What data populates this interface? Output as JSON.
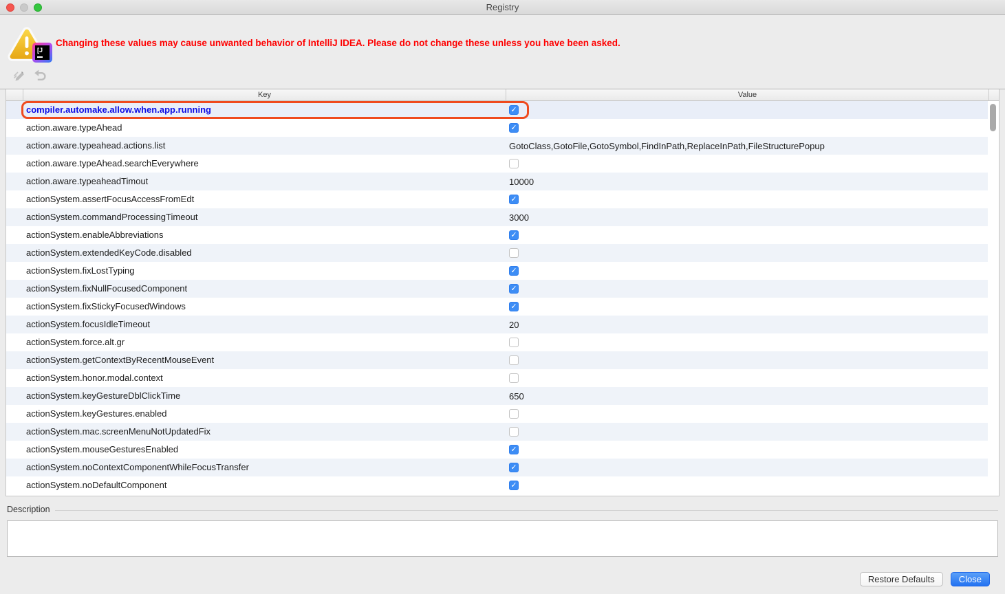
{
  "window": {
    "title": "Registry"
  },
  "warning": {
    "text": "Changing these values may cause unwanted behavior of IntelliJ IDEA. Please do not change these unless you have been asked.",
    "logo_text": "[J"
  },
  "toolbar": {
    "icons": [
      "edit-icon",
      "revert-icon"
    ]
  },
  "table": {
    "header": {
      "key": "Key",
      "value": "Value"
    },
    "rows": [
      {
        "key": "compiler.automake.allow.when.app.running",
        "type": "checkbox",
        "checked": true,
        "selected": true,
        "highlighted": true
      },
      {
        "key": "action.aware.typeAhead",
        "type": "checkbox",
        "checked": true
      },
      {
        "key": "action.aware.typeahead.actions.list",
        "type": "text",
        "value": "GotoClass,GotoFile,GotoSymbol,FindInPath,ReplaceInPath,FileStructurePopup"
      },
      {
        "key": "action.aware.typeAhead.searchEverywhere",
        "type": "checkbox",
        "checked": false
      },
      {
        "key": "action.aware.typeaheadTimout",
        "type": "text",
        "value": "10000"
      },
      {
        "key": "actionSystem.assertFocusAccessFromEdt",
        "type": "checkbox",
        "checked": true
      },
      {
        "key": "actionSystem.commandProcessingTimeout",
        "type": "text",
        "value": "3000"
      },
      {
        "key": "actionSystem.enableAbbreviations",
        "type": "checkbox",
        "checked": true
      },
      {
        "key": "actionSystem.extendedKeyCode.disabled",
        "type": "checkbox",
        "checked": false
      },
      {
        "key": "actionSystem.fixLostTyping",
        "type": "checkbox",
        "checked": true
      },
      {
        "key": "actionSystem.fixNullFocusedComponent",
        "type": "checkbox",
        "checked": true
      },
      {
        "key": "actionSystem.fixStickyFocusedWindows",
        "type": "checkbox",
        "checked": true
      },
      {
        "key": "actionSystem.focusIdleTimeout",
        "type": "text",
        "value": "20"
      },
      {
        "key": "actionSystem.force.alt.gr",
        "type": "checkbox",
        "checked": false
      },
      {
        "key": "actionSystem.getContextByRecentMouseEvent",
        "type": "checkbox",
        "checked": false
      },
      {
        "key": "actionSystem.honor.modal.context",
        "type": "checkbox",
        "checked": false
      },
      {
        "key": "actionSystem.keyGestureDblClickTime",
        "type": "text",
        "value": "650"
      },
      {
        "key": "actionSystem.keyGestures.enabled",
        "type": "checkbox",
        "checked": false
      },
      {
        "key": "actionSystem.mac.screenMenuNotUpdatedFix",
        "type": "checkbox",
        "checked": false
      },
      {
        "key": "actionSystem.mouseGesturesEnabled",
        "type": "checkbox",
        "checked": true
      },
      {
        "key": "actionSystem.noContextComponentWhileFocusTransfer",
        "type": "checkbox",
        "checked": true
      },
      {
        "key": "actionSystem.noDefaultComponent",
        "type": "checkbox",
        "checked": true
      }
    ]
  },
  "description": {
    "label": "Description",
    "content": ""
  },
  "footer": {
    "restore_defaults_label": "Restore Defaults",
    "close_label": "Close"
  },
  "icons": {
    "checkbox_check": "✓"
  },
  "colors": {
    "window_bg": "#ececec",
    "titlebar_top": "#e8e8e8",
    "titlebar_bottom": "#d9d9d9",
    "warning_text": "#fe0000",
    "selected_key_text": "#0b0be4",
    "selected_row_bg": "#e9eef8",
    "stripe": "#eff3f9",
    "highlight_orange": "#ef4a1e",
    "checkbox_blue": "#3d8df5",
    "close_btn_top": "#5ba0f8",
    "close_btn_bottom": "#2372f1",
    "scrollbar_thumb": "#a9a9a9",
    "traffic_red": "#f5564f",
    "traffic_gray": "#c9c9c9",
    "traffic_green": "#34c63e"
  }
}
